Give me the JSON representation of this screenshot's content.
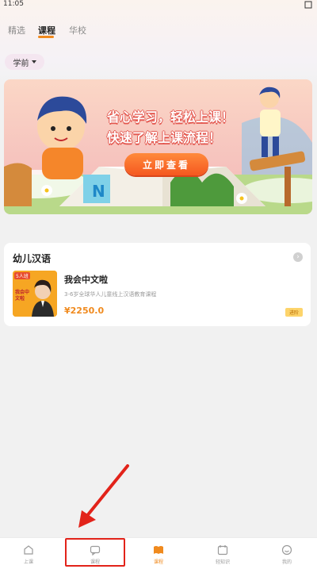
{
  "status_bar": {
    "time": "11:05"
  },
  "tabs": [
    {
      "label": "精选",
      "active": false
    },
    {
      "label": "课程",
      "active": true
    },
    {
      "label": "华校",
      "active": false
    }
  ],
  "filter": {
    "selected": "学前"
  },
  "banner": {
    "line1": "省心学习，轻松上课！",
    "line2": "快速了解上课流程！",
    "button_label": "立即查看"
  },
  "course_section": {
    "title": "幼儿汉语",
    "course": {
      "thumbnail_tag": "5人班",
      "thumbnail_text": "我会中文啦",
      "name": "我会中文啦",
      "description": "3-6岁全球华人儿童线上汉语教育课程",
      "price": "¥2250.0",
      "badge": "进阶"
    }
  },
  "bottom_nav": {
    "items": [
      {
        "label": "上课",
        "icon": "home-icon",
        "active": false
      },
      {
        "label": "课程",
        "icon": "message-icon",
        "active": false
      },
      {
        "label": "课程",
        "icon": "book-icon",
        "active": true
      },
      {
        "label": "轻知识",
        "icon": "calendar-icon",
        "active": false
      },
      {
        "label": "我的",
        "icon": "profile-icon",
        "active": false
      }
    ]
  },
  "colors": {
    "accent": "#f08a1e",
    "highlight_annotation": "#e2231a"
  }
}
